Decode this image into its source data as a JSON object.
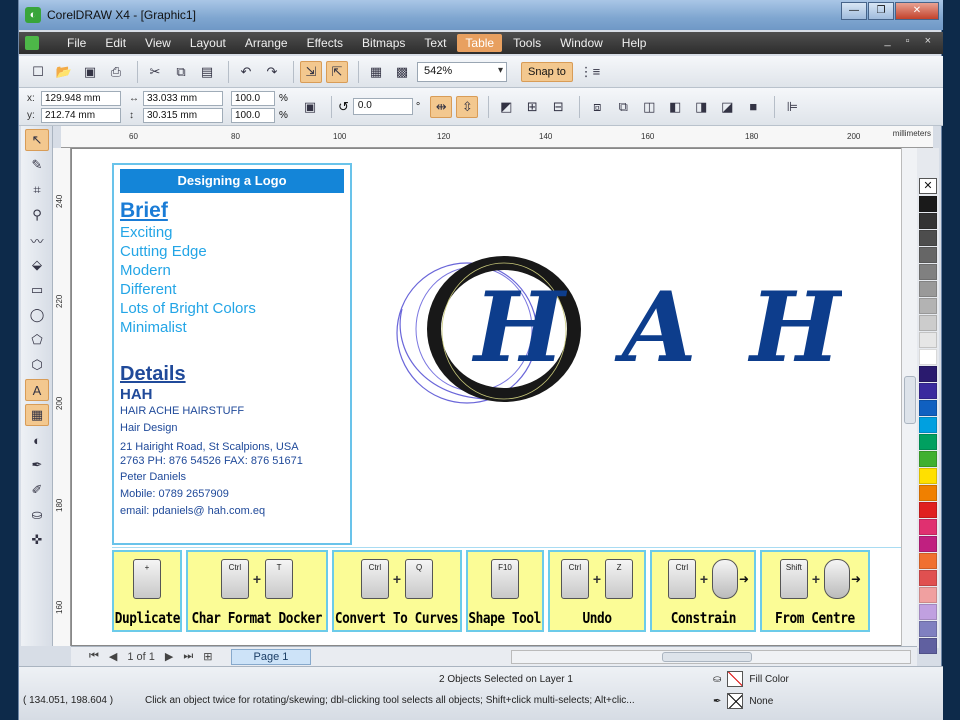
{
  "window": {
    "title": "CorelDRAW X4 - [Graphic1]",
    "controls": [
      "—",
      "❐",
      "✕"
    ]
  },
  "menu": {
    "items": [
      "File",
      "Edit",
      "View",
      "Layout",
      "Arrange",
      "Effects",
      "Bitmaps",
      "Text",
      "Table",
      "Tools",
      "Window",
      "Help"
    ],
    "active": "Table",
    "doc_controls": "_ ▫ ×"
  },
  "toolbar": {
    "zoom": "542%",
    "snap_label": "Snap to"
  },
  "properties": {
    "x": "129.948 mm",
    "y": "212.74 mm",
    "w": "33.033 mm",
    "h": "30.315 mm",
    "scale_x": "100.0",
    "scale_y": "100.0",
    "pct": "%",
    "rotation": "0.0",
    "deg": "°",
    "x_label": "x:",
    "y_label": "y:"
  },
  "ruler": {
    "ticks": [
      "60",
      "80",
      "100",
      "120",
      "140",
      "160",
      "180",
      "200"
    ],
    "unit": "millimeters",
    "vticks": [
      "240",
      "220",
      "200",
      "180",
      "160"
    ],
    "vunit": "millimeters"
  },
  "brief": {
    "banner": "Designing a Logo",
    "brief_heading": "Brief",
    "brief_items": [
      "Exciting",
      "Cutting Edge",
      "Modern",
      "Different",
      "Lots of Bright Colors",
      "Minimalist"
    ],
    "details_heading": "Details",
    "hah": "HAH",
    "company": "HAIR ACHE HAIRSTUFF",
    "service": "Hair Design",
    "address1": "21 Hairight Road, St Scalpions, USA",
    "address2": "2763  PH: 876 54526   FAX: 876 51671",
    "contact": "Peter Daniels",
    "mobile": "Mobile: 0789 2657909",
    "email": "email: pdaniels@ hah.com.eq"
  },
  "logo": {
    "letters": [
      "H",
      "A",
      "H"
    ],
    "color": "#0d3d8c"
  },
  "hotkeys": [
    {
      "keys": [
        "+"
      ],
      "mouse": false,
      "label": "Duplicate"
    },
    {
      "keys": [
        "Ctrl",
        "T"
      ],
      "mouse": false,
      "label": "Char Format Docker"
    },
    {
      "keys": [
        "Ctrl",
        "Q"
      ],
      "mouse": false,
      "label": "Convert To Curves"
    },
    {
      "keys": [
        "F10"
      ],
      "mouse": false,
      "label": "Shape Tool"
    },
    {
      "keys": [
        "Ctrl",
        "Z"
      ],
      "mouse": false,
      "label": "Undo"
    },
    {
      "keys": [
        "Ctrl"
      ],
      "mouse": true,
      "label": "Constrain"
    },
    {
      "keys": [
        "Shift"
      ],
      "mouse": true,
      "label": "From Centre"
    }
  ],
  "pagenav": {
    "count": "1 of 1",
    "tab": "Page 1"
  },
  "status": {
    "objects": "2 Objects Selected on Layer 1",
    "coords": "( 134.051, 198.604 )",
    "hint": "Click an object twice for rotating/skewing; dbl-clicking tool selects all objects; Shift+click multi-selects; Alt+clic...",
    "fill_label": "Fill Color",
    "outline_label": "None"
  },
  "palette": [
    "#1a1a1a",
    "#333333",
    "#4d4d4d",
    "#666666",
    "#808080",
    "#999999",
    "#b3b3b3",
    "#cccccc",
    "#e6e6e6",
    "#ffffff",
    "#2a1a6e",
    "#3a2a9e",
    "#1060c0",
    "#00a0e0",
    "#00a060",
    "#40b030",
    "#ffe000",
    "#f08000",
    "#e02020",
    "#e03070",
    "#c02080",
    "#f07030",
    "#e05050",
    "#f0a0a0",
    "#c0a0e0",
    "#8080c0",
    "#6060a0"
  ]
}
